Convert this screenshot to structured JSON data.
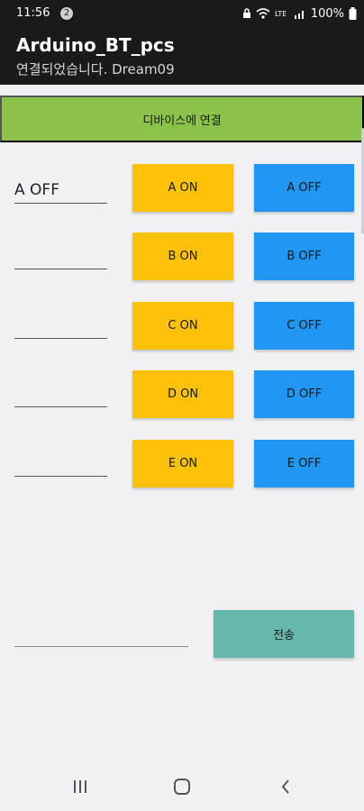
{
  "status_bar": {
    "time": "11:56",
    "notification_count": "2",
    "battery": "100%"
  },
  "app": {
    "title": "Arduino_BT_pcs",
    "subtitle": "연결되었습니다. Dream09"
  },
  "connect_button": {
    "label": "디바이스에 연결"
  },
  "rows": [
    {
      "field_value": "A OFF",
      "on_label": "A ON",
      "off_label": "A OFF"
    },
    {
      "field_value": "",
      "on_label": "B ON",
      "off_label": "B OFF"
    },
    {
      "field_value": "",
      "on_label": "C ON",
      "off_label": "C OFF"
    },
    {
      "field_value": "",
      "on_label": "D ON",
      "off_label": "D OFF"
    },
    {
      "field_value": "",
      "on_label": "E ON",
      "off_label": "E OFF"
    }
  ],
  "send": {
    "input_value": "",
    "button_label": "전송"
  },
  "colors": {
    "header_bg": "#1a1a1a",
    "connect_bar": "#8bc34a",
    "on_button": "#ffc107",
    "off_button": "#2196f3",
    "send_button": "#66b8ad"
  },
  "nav": {
    "icons": [
      "recent-apps-icon",
      "home-icon",
      "back-icon"
    ]
  }
}
